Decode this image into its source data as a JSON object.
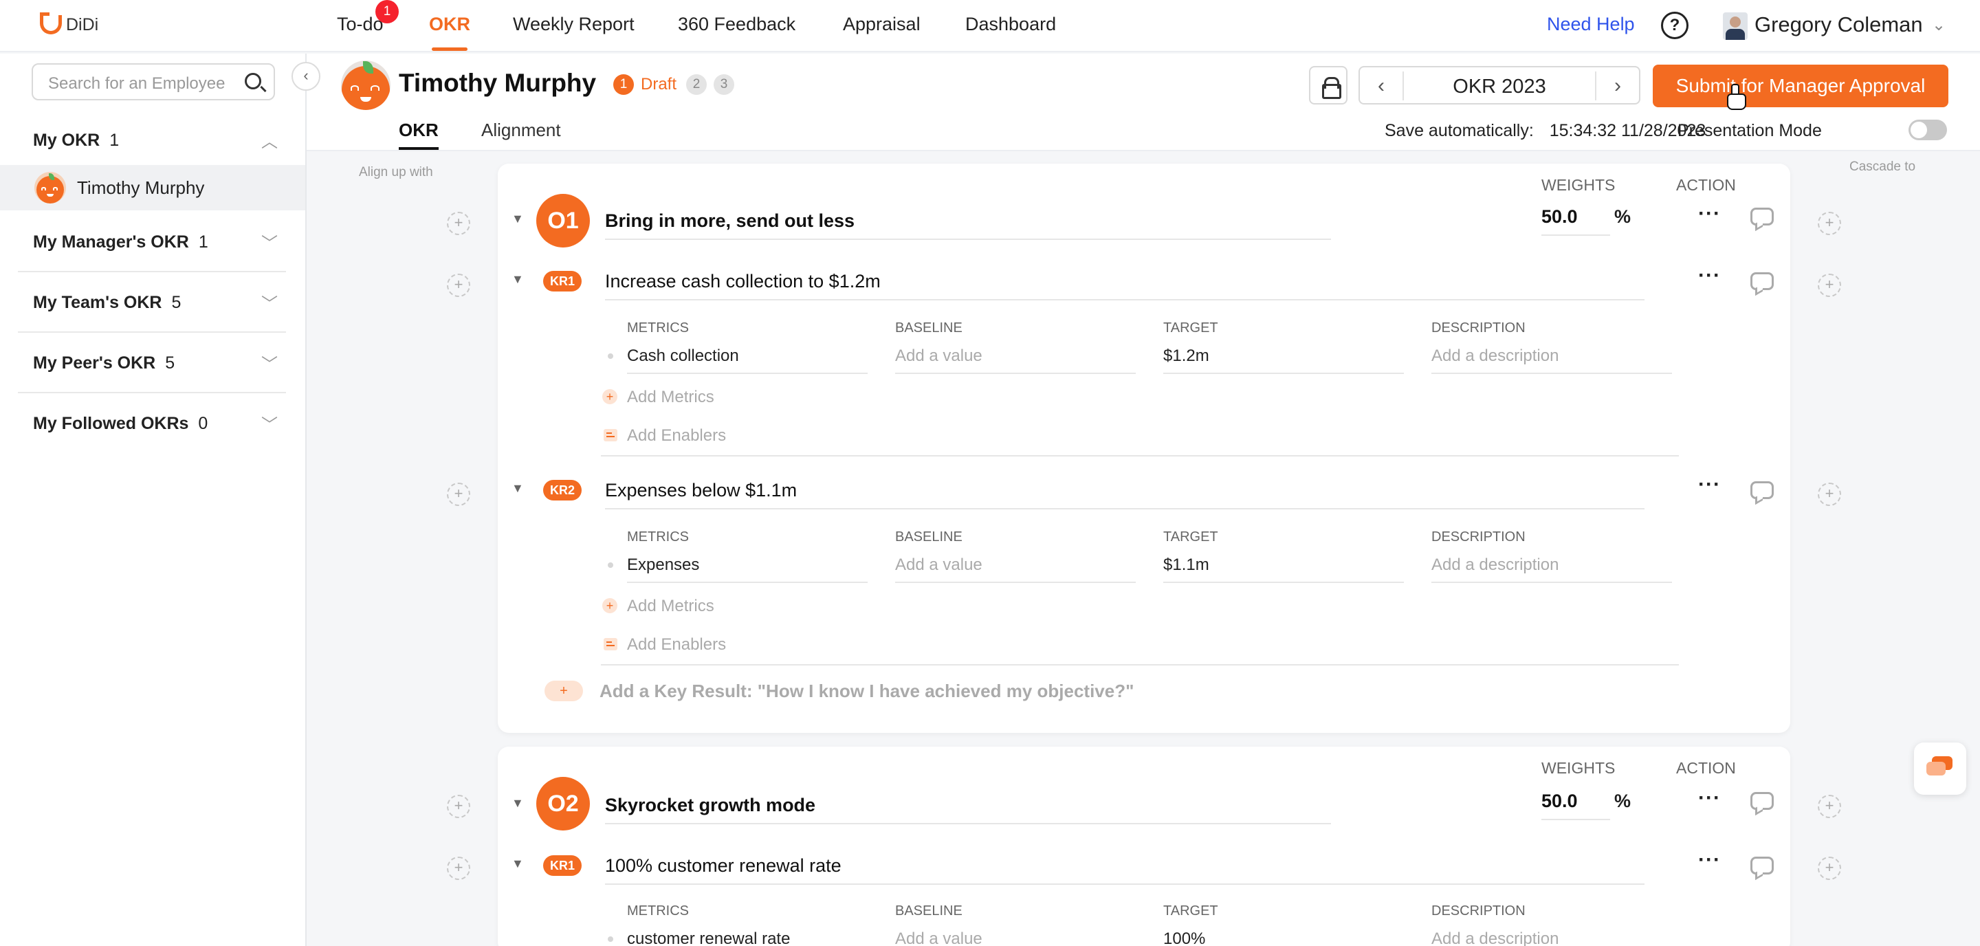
{
  "nav": {
    "logo": "DiDi",
    "items": [
      {
        "label": "To-do",
        "badge": "1"
      },
      {
        "label": "OKR"
      },
      {
        "label": "Weekly Report"
      },
      {
        "label": "360 Feedback"
      },
      {
        "label": "Appraisal"
      },
      {
        "label": "Dashboard"
      }
    ],
    "need_help": "Need Help",
    "help_glyph": "?",
    "user_name": "Gregory Coleman"
  },
  "sidebar": {
    "search_placeholder": "Search for an Employee",
    "sections": [
      {
        "title": "My OKR",
        "count": "1",
        "members": [
          "Timothy Murphy"
        ]
      },
      {
        "title": "My Manager's OKR",
        "count": "1"
      },
      {
        "title": "My Team's OKR",
        "count": "5"
      },
      {
        "title": "My Peer's OKR",
        "count": "5"
      },
      {
        "title": "My Followed OKRs",
        "count": "0"
      }
    ]
  },
  "header": {
    "name": "Timothy Murphy",
    "steps": [
      "1",
      "2",
      "3"
    ],
    "step_label": "Draft",
    "period": "OKR 2023",
    "submit": "Submit for Manager Approval",
    "tabs": [
      "OKR",
      "Alignment"
    ],
    "save_label": "Save automatically:",
    "save_time": "15:34:32 11/28/2023",
    "presentation_mode": "Presentation Mode"
  },
  "labels": {
    "align_up": "Align up with",
    "cascade": "Cascade to",
    "weights": "WEIGHTS",
    "action": "ACTION",
    "metrics": "METRICS",
    "baseline": "BASELINE",
    "target": "TARGET",
    "description": "DESCRIPTION",
    "add_metrics": "Add Metrics",
    "add_enablers": "Add Enablers",
    "add_kr": "Add a Key Result: \"How I know I have achieved my objective?\"",
    "baseline_placeholder": "Add a value",
    "description_placeholder": "Add a description",
    "percent": "%",
    "more": "···",
    "add": "+"
  },
  "objectives": [
    {
      "code": "O1",
      "title": "Bring in more, send out less",
      "weight": "50.0",
      "krs": [
        {
          "code": "KR1",
          "title": "Increase cash collection to $1.2m",
          "metric": "Cash collection",
          "target": "$1.2m"
        },
        {
          "code": "KR2",
          "title": "Expenses below $1.1m",
          "metric": "Expenses",
          "target": "$1.1m"
        }
      ]
    },
    {
      "code": "O2",
      "title": "Skyrocket growth mode",
      "weight": "50.0",
      "krs": [
        {
          "code": "KR1",
          "title": "100% customer renewal rate",
          "metric": "customer renewal rate",
          "target": "100%"
        }
      ]
    }
  ],
  "colors": {
    "accent": "#f36b21",
    "badge": "#f5222d",
    "link": "#2f54eb"
  }
}
